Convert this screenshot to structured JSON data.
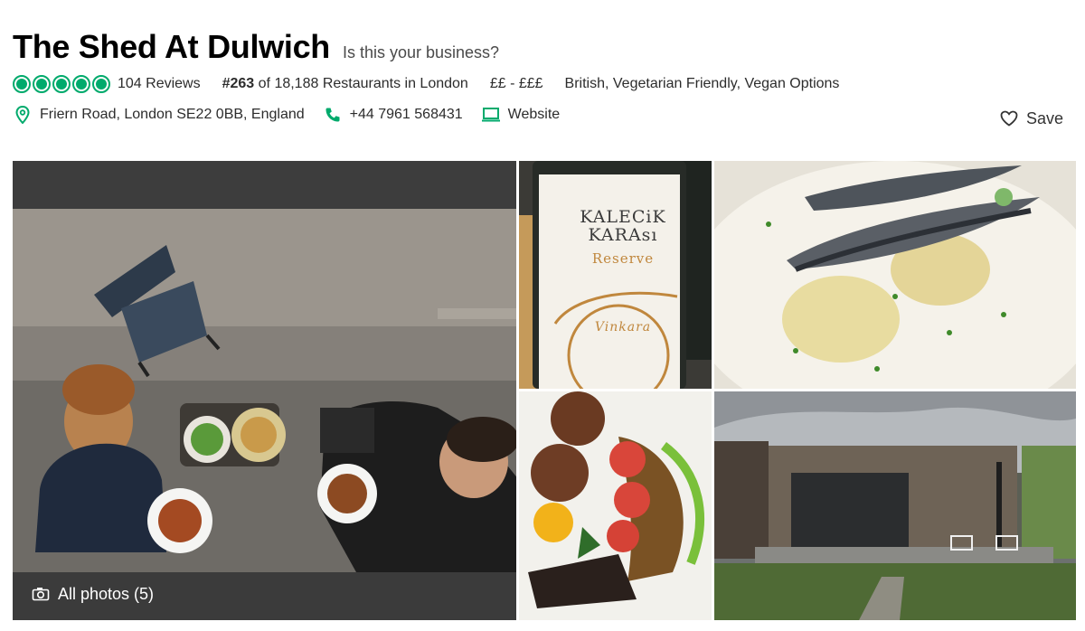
{
  "restaurant": {
    "name": "The Shed At Dulwich",
    "claim_link": "Is this your business?",
    "rating_bubbles": 5,
    "reviews": "104 Reviews",
    "rank_number": "#263",
    "rank_text": " of 18,188 Restaurants in London",
    "price": "££ - £££",
    "cuisines": "British, Vegetarian Friendly, Vegan Options",
    "address": "Friern Road, London SE22 0BB, England",
    "phone": "+44 7961 568431",
    "website": "Website",
    "save_label": "Save"
  },
  "gallery": {
    "all_photos_label": "All photos (5)",
    "photos": [
      {
        "subject": "two-men-eating-outdoors"
      },
      {
        "subject": "wine-bottle-kalecik-karasi"
      },
      {
        "subject": "fish-with-potatoes"
      },
      {
        "subject": "meatballs-dish"
      },
      {
        "subject": "wooden-shed-exterior"
      }
    ],
    "wine_label_line1": "KALECiK",
    "wine_label_line2": "KARAsı",
    "wine_label_line3": "Reserve",
    "wine_label_brand": "Vinkara"
  },
  "colors": {
    "accent": "#00aa6c",
    "text": "#2c2c2c"
  }
}
